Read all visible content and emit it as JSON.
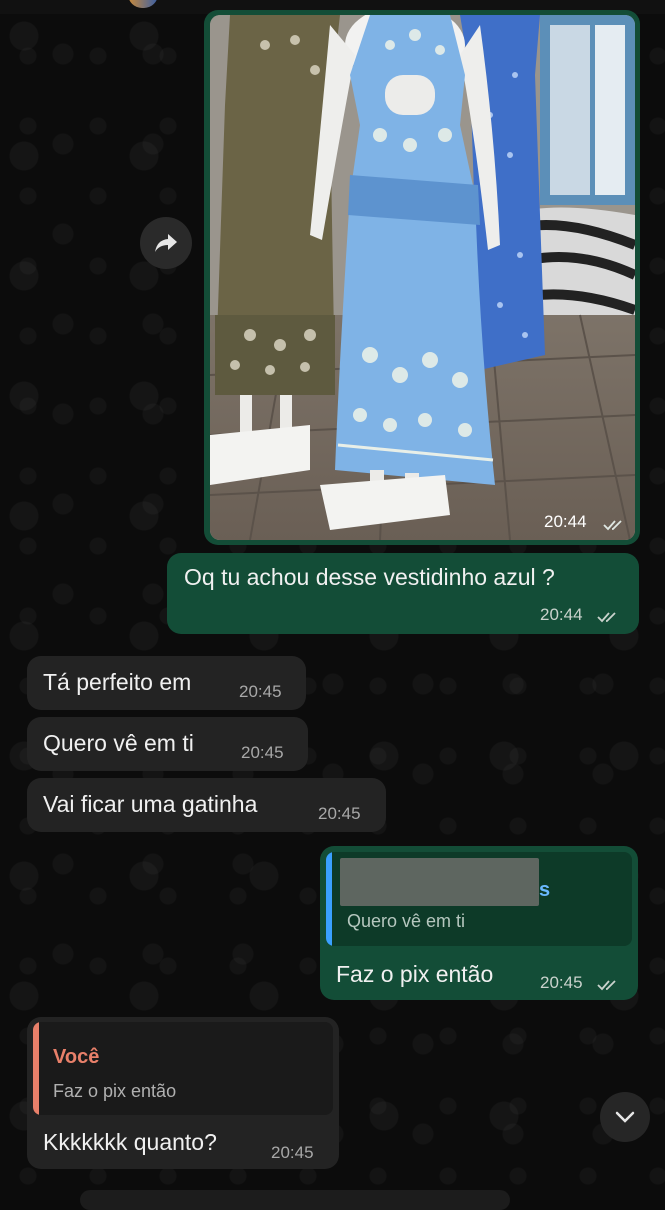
{
  "messages": {
    "image_message": {
      "time": "20:44",
      "status": "read"
    },
    "msg1": {
      "text": "Oq tu achou desse vestidinho azul ?",
      "time": "20:44",
      "status": "read"
    },
    "msg2": {
      "text": "Tá perfeito em",
      "time": "20:45"
    },
    "msg3": {
      "text": "Quero vê em ti",
      "time": "20:45"
    },
    "msg4": {
      "text": "Vai ficar uma gatinha",
      "time": "20:45"
    },
    "msg5": {
      "quote_name": "s",
      "quote_text": "Quero vê em ti",
      "text": "Faz o pix então",
      "time": "20:45",
      "status": "read"
    },
    "msg6": {
      "quote_name": "Você",
      "quote_text": "Faz o pix então",
      "text": "Kkkkkkk quanto?",
      "time": "20:45"
    }
  },
  "icons": {
    "forward": "forward-arrow-icon",
    "scroll": "chevron-down-icon",
    "ticks": "double-check-icon"
  },
  "colors": {
    "outgoing_bubble": "#134d37",
    "incoming_bubble": "#232323",
    "quote_own_accent": "#e8806a",
    "quote_other_accent": "#3aa0ff",
    "read_ticks": "#c9d2cc"
  }
}
